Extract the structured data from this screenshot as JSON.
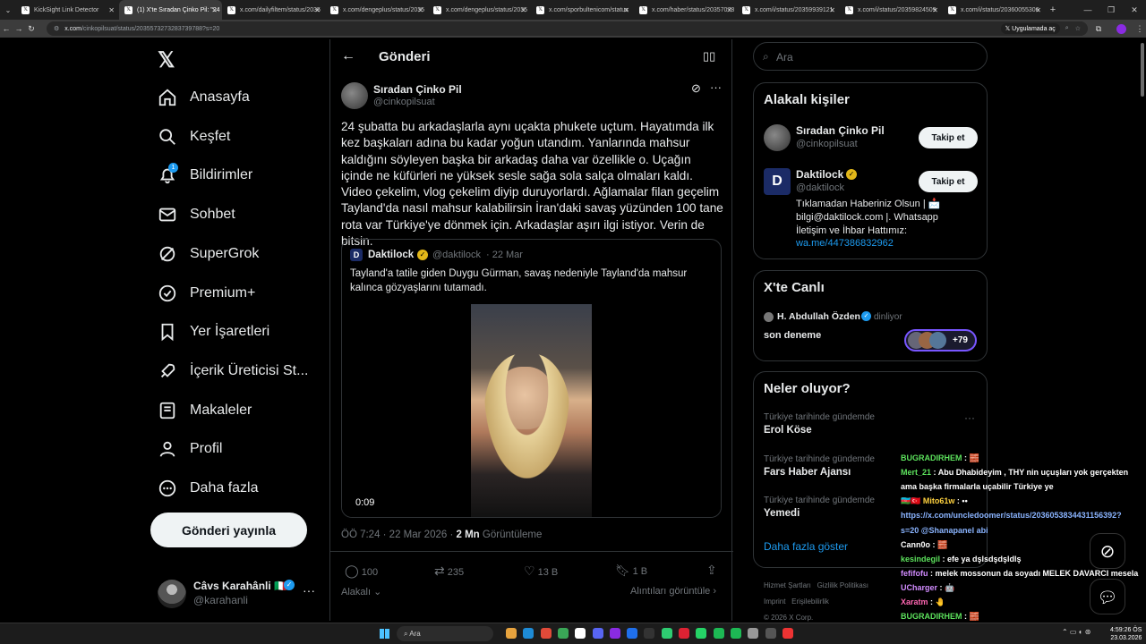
{
  "browser": {
    "tabs": [
      {
        "title": "KickSight Link Detector",
        "active": false
      },
      {
        "title": "(1) X'te Sıradan Çinko Pil: \"24",
        "active": true
      },
      {
        "title": "x.com/dailyfiltem/status/2035",
        "active": false
      },
      {
        "title": "x.com/dengeplus/status/2035",
        "active": false
      },
      {
        "title": "x.com/dengeplus/status/2035",
        "active": false
      },
      {
        "title": "x.com/sporbultenicom/status",
        "active": false
      },
      {
        "title": "x.com/haber/status/20357078",
        "active": false
      },
      {
        "title": "x.com/i/status/20359939121",
        "active": false
      },
      {
        "title": "x.com/i/status/20359824509",
        "active": false
      },
      {
        "title": "x.com/i/status/20360055306",
        "active": false
      }
    ],
    "new_tab": "+",
    "url_domain": "x.com",
    "url_path": "/cinkopilsuat/status/2035573273283739788?s=20",
    "app_badge": "Uygulamada aç"
  },
  "nav": {
    "items": [
      {
        "label": "Anasayfa",
        "icon": "home-icon"
      },
      {
        "label": "Keşfet",
        "icon": "search-icon"
      },
      {
        "label": "Bildirimler",
        "icon": "bell-icon",
        "badge": "1"
      },
      {
        "label": "Sohbet",
        "icon": "mail-icon"
      },
      {
        "label": "SuperGrok",
        "icon": "grok-icon"
      },
      {
        "label": "Premium+",
        "icon": "verified-icon"
      },
      {
        "label": "Yer İşaretleri",
        "icon": "bookmark-icon"
      },
      {
        "label": "İçerik Üreticisi St...",
        "icon": "rocket-icon"
      },
      {
        "label": "Makaleler",
        "icon": "article-icon"
      },
      {
        "label": "Profil",
        "icon": "person-icon"
      },
      {
        "label": "Daha fazla",
        "icon": "more-circle-icon"
      }
    ],
    "post_button": "Gönderi yayınla",
    "account": {
      "name": "Câvs Karahânli 🇮🇹",
      "handle": "@karahanli"
    }
  },
  "post": {
    "header_title": "Gönderi",
    "author_name": "Sıradan Çinko Pil",
    "author_handle": "@cinkopilsuat",
    "text": "24 şubatta bu arkadaşlarla aynı uçakta phukete uçtum. Hayatımda ilk kez başkaları adına bu kadar yoğun utandım. Yanlarında mahsur kaldığını söyleyen başka bir arkadaş daha var özellikle o. Uçağın içinde ne küfürleri ne yüksek sesle sağa sola salça olmaları kaldı. Video çekelim, vlog çekelim diyip duruyorlardı. Ağlamalar filan geçelim Tayland'da nasıl mahsur kalabilirsin İran'daki savaş yüzünden 100 tane rota var Türkiye'ye dönmek için. Arkadaşlar aşırı ilgi istiyor. Verin de bitsin.",
    "quote": {
      "author": "Daktilock",
      "handle": "@daktilock",
      "date": "· 22 Mar",
      "text": "Tayland'a tatile giden Duygu Gürman, savaş nedeniyle Tayland'da mahsur kalınca gözyaşlarını tutamadı.",
      "video_time": "0:09"
    },
    "meta_time": "ÖÖ 7:24 · 22 Mar 2026 ·",
    "meta_views": "2 Mn",
    "meta_views_label": "Görüntüleme",
    "stats": {
      "replies": "100",
      "reposts": "235",
      "likes": "13 B",
      "bookmarks": "1 B"
    },
    "sort_label": "Alakalı",
    "quotes_link": "Alıntıları görüntüle"
  },
  "right": {
    "search_placeholder": "Ara",
    "related_title": "Alakalı kişiler",
    "related": [
      {
        "name": "Sıradan Çinko Pil",
        "handle": "@cinkopilsuat",
        "follow": "Takip et"
      },
      {
        "name": "Daktilock",
        "handle": "@daktilock",
        "follow": "Takip et",
        "bio": "Tıklamadan Haberiniz Olsun | 📩 bilgi@daktilock.com |. Whatsapp İletişim ve İhbar Hattımız:",
        "link": "wa.me/447386832962"
      }
    ],
    "live_title": "X'te Canlı",
    "live_host": "H. Abdullah Özden",
    "live_status": "dinliyor",
    "live_space": "son deneme",
    "live_count": "+79",
    "trends_title": "Neler oluyor?",
    "trends": [
      {
        "context": "Türkiye tarihinde gündemde",
        "name": "Erol Köse"
      },
      {
        "context": "Türkiye tarihinde gündemde",
        "name": "Fars Haber Ajansı"
      },
      {
        "context": "Türkiye tarihinde gündemde",
        "name": "Yemedi"
      }
    ],
    "show_more": "Daha fazla göster",
    "footer": [
      "Hizmet Şartları",
      "Gizlilik Politikası",
      "Çerez Politikası",
      "Imprint",
      "Erişilebilirlik",
      "Reklam bilgisi",
      "Daha fazla ...",
      "© 2026 X Corp."
    ]
  },
  "chat_overlay": [
    {
      "user": "BUGRADIRHEM",
      "msg": " : 🧱",
      "color": "#5ce15c"
    },
    {
      "user": "Mert_21",
      "msg": " : Abu Dhabideyim , THY nin uçuşları yok gerçekten",
      "color": "#5ce15c"
    },
    {
      "user": "",
      "msg": "ama başka firmalarla uçabilir Türkiye ye",
      "color": "#ffffff"
    },
    {
      "user": "🇦🇿🇹🇷 Mito61w",
      "msg": " : ••",
      "color": "#ffd23f"
    },
    {
      "user": "",
      "msg": "https://x.com/uncledoomer/status/2036053834431156392?",
      "color": "#8ab4ff"
    },
    {
      "user": "",
      "msg": "s=20 @Shanapanel abi",
      "color": "#8ab4ff"
    },
    {
      "user": "Cann0o",
      "msg": " : 🧱",
      "color": "#ffffff"
    },
    {
      "user": "kesindegil",
      "msg": " : efe ya dşlsdşdşldlş",
      "color": "#5ce15c"
    },
    {
      "user": "fefifofu",
      "msg": " : melek mossonun da soyadı MELEK DAVARCI mesela",
      "color": "#d28cff"
    },
    {
      "user": "UCharger",
      "msg": " : 🤖",
      "color": "#d28cff"
    },
    {
      "user": "Xaratm",
      "msg": " : 🤚",
      "color": "#ff66b2"
    },
    {
      "user": "BUGRADIRHEM",
      "msg": " : 🧱",
      "color": "#5ce15c"
    }
  ],
  "taskbar": {
    "search": "Ara",
    "time": "4:59:26 ÖS",
    "date": "23.03.2026"
  }
}
